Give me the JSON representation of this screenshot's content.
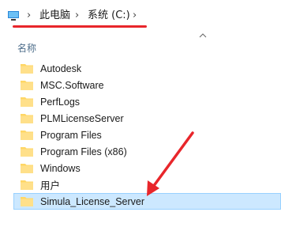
{
  "breadcrumb": {
    "items": [
      "此电脑",
      "系统 (C:)"
    ]
  },
  "column_header": {
    "name_label": "名称"
  },
  "files": [
    {
      "name": "Autodesk"
    },
    {
      "name": "MSC.Software"
    },
    {
      "name": "PerfLogs"
    },
    {
      "name": "PLMLicenseServer"
    },
    {
      "name": "Program Files"
    },
    {
      "name": "Program Files (x86)"
    },
    {
      "name": "Windows"
    },
    {
      "name": "用户"
    },
    {
      "name": "Simula_License_Server",
      "selected": true
    }
  ],
  "colors": {
    "annotation_red": "#e8262b",
    "selection_bg": "#cce8ff",
    "folder_yellow": "#ffd766"
  },
  "icons": [
    "computer-icon",
    "chevron-right-icon",
    "sort-up-icon",
    "folder-icon",
    "annotation-arrow"
  ]
}
